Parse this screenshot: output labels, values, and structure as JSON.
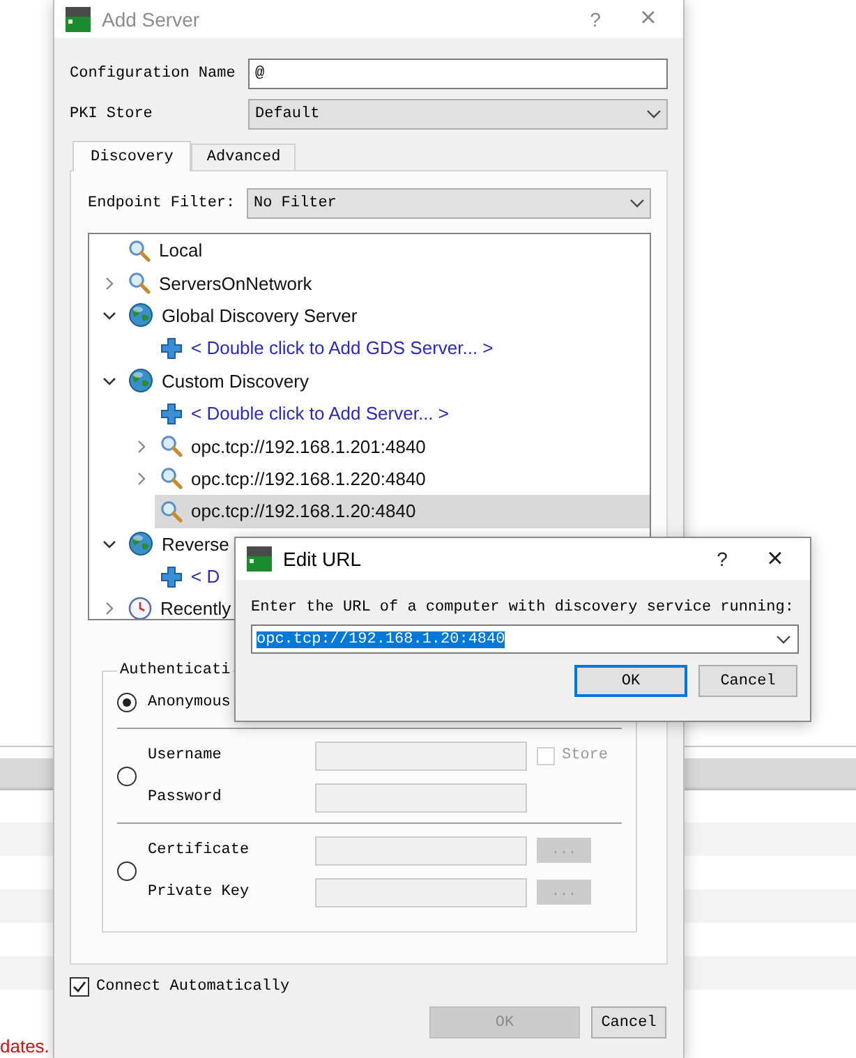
{
  "background_app": {
    "status_text": "dates."
  },
  "add_server": {
    "title": "Add Server",
    "active": false,
    "help": "?",
    "close": "×",
    "fields": [
      {
        "label": "Configuration Name",
        "kind": "text",
        "value": "@"
      },
      {
        "label": "PKI Store",
        "kind": "combo",
        "value": "Default"
      }
    ],
    "tabs": [
      {
        "label": "Discovery",
        "selected": true
      },
      {
        "label": "Advanced",
        "selected": false
      }
    ],
    "endpoint_filter": {
      "label": "Endpoint Filter:",
      "value": "No Filter"
    },
    "tree": [
      {
        "label": "Local",
        "kind": "search",
        "selected": false
      },
      {
        "label": "ServersOnNetwork",
        "kind": "search",
        "expanded": false,
        "selected": false
      },
      {
        "label": "Global Discovery Server",
        "kind": "globe",
        "expanded": true,
        "selected": false,
        "children": [
          {
            "label": "< Double click to Add GDS Server... >",
            "kind": "add",
            "selected": false
          }
        ]
      },
      {
        "label": "Custom Discovery",
        "kind": "globe",
        "expanded": true,
        "selected": false,
        "children": [
          {
            "label": "< Double click to Add Server... >",
            "kind": "add",
            "selected": false
          },
          {
            "label": "opc.tcp://192.168.1.201:4840",
            "kind": "search",
            "expanded": false,
            "selected": false
          },
          {
            "label": "opc.tcp://192.168.1.220:4840",
            "kind": "search",
            "expanded": false,
            "selected": false
          },
          {
            "label": "opc.tcp://192.168.1.20:4840",
            "kind": "search",
            "selected": true
          }
        ]
      },
      {
        "label": "Reverse",
        "kind": "globe",
        "expanded": true,
        "selected": false,
        "children": [
          {
            "label": "< D",
            "kind": "add",
            "selected": false
          }
        ]
      },
      {
        "label": "Recently",
        "kind": "clock",
        "expanded": false,
        "selected": false
      }
    ],
    "authentication": {
      "title": "Authenticati",
      "options": [
        {
          "selected": true,
          "rows": [
            {
              "label": "Anonymous",
              "kind": "plain"
            }
          ]
        },
        {
          "selected": false,
          "rows": [
            {
              "label": "Username",
              "kind": "field",
              "store": {
                "label": "Store",
                "checked": false
              }
            },
            {
              "label": "Password",
              "kind": "field"
            }
          ]
        },
        {
          "selected": false,
          "rows": [
            {
              "label": "Certificate",
              "kind": "field",
              "browse": "..."
            },
            {
              "label": "Private Key",
              "kind": "field",
              "browse": "..."
            }
          ]
        }
      ]
    },
    "connect_automatically": {
      "label": "Connect Automatically",
      "checked": true
    },
    "buttons": [
      {
        "label": "OK",
        "disabled": true
      },
      {
        "label": "Cancel",
        "disabled": false
      }
    ]
  },
  "edit_url": {
    "title": "Edit URL",
    "active": true,
    "help": "?",
    "close": "×",
    "prompt": "Enter the URL of a computer with discovery service running:",
    "value": "opc.tcp://192.168.1.20:4840",
    "value_selected": true,
    "buttons": [
      {
        "label": "OK",
        "focused": true
      },
      {
        "label": "Cancel",
        "focused": false
      }
    ]
  }
}
